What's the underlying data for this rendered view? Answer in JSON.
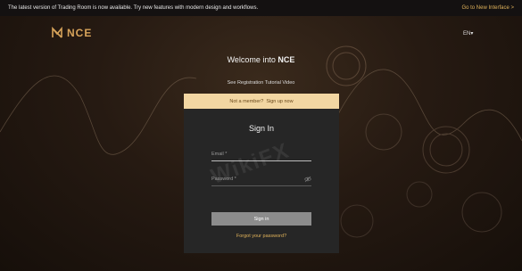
{
  "banner": {
    "message": "The latest version of Trading Room is now available. Try new features with modern design and workflows.",
    "link": "Go to New Interface >"
  },
  "brand": {
    "name": "NCE"
  },
  "lang": {
    "label": "EN",
    "chevron": "▾"
  },
  "welcome": {
    "prefix": "Welcome into ",
    "brand": "NCE"
  },
  "tutorial": {
    "label": "See Registration Tutorial Video"
  },
  "member_bar": {
    "text": "Not a member?",
    "link": "Sign up now"
  },
  "signin_card": {
    "title": "Sign In",
    "email": {
      "label": "Email *"
    },
    "password": {
      "label": "Password *"
    },
    "button": "Sign in",
    "forgot": "Forgot your password?"
  },
  "watermark": "WikiFX",
  "colors": {
    "accent": "#e0b25a",
    "member_bg": "#f2d6a2",
    "card_bg": "#262626",
    "button_bg": "#8c8c8c"
  }
}
